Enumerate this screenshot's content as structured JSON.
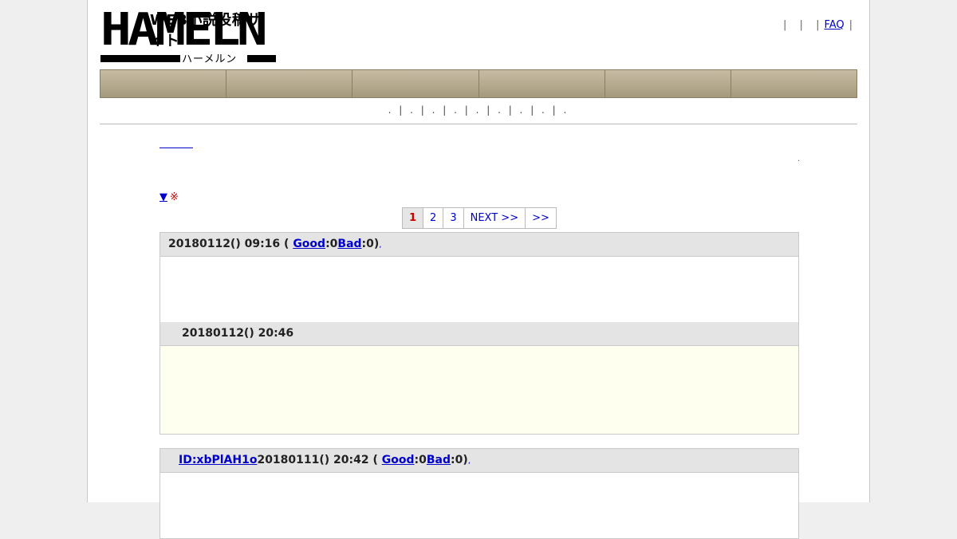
{
  "header": {
    "logo_tagline": "WEB小説投稿サイト",
    "logo_name": "HAMELN",
    "logo_kana": "ハーメルン",
    "faq_label": "FAQ"
  },
  "nav": {
    "items": [
      "",
      "",
      "",
      "",
      "",
      ""
    ]
  },
  "subnav": {
    "text": ". | . | . | . | . | . | . | . | ."
  },
  "content": {
    "marker_triangle": "▼",
    "marker_kome": "※"
  },
  "pager": {
    "pages": [
      "1",
      "2",
      "3",
      "NEXT >>",
      ">>"
    ],
    "current": "1"
  },
  "reviews": [
    {
      "id": "",
      "datetime": "20180112() 09:16 (",
      "good_label": "Good",
      "good_count": ":0",
      "bad_label": "Bad",
      "bad_count": ":0)",
      "reply_datetime": "20180112() 20:46"
    },
    {
      "id": "ID:xbPlAH1o",
      "datetime": "20180111() 20:42 (",
      "good_label": "Good",
      "good_count": ":0",
      "bad_label": "Bad",
      "bad_count": ":0)"
    }
  ]
}
